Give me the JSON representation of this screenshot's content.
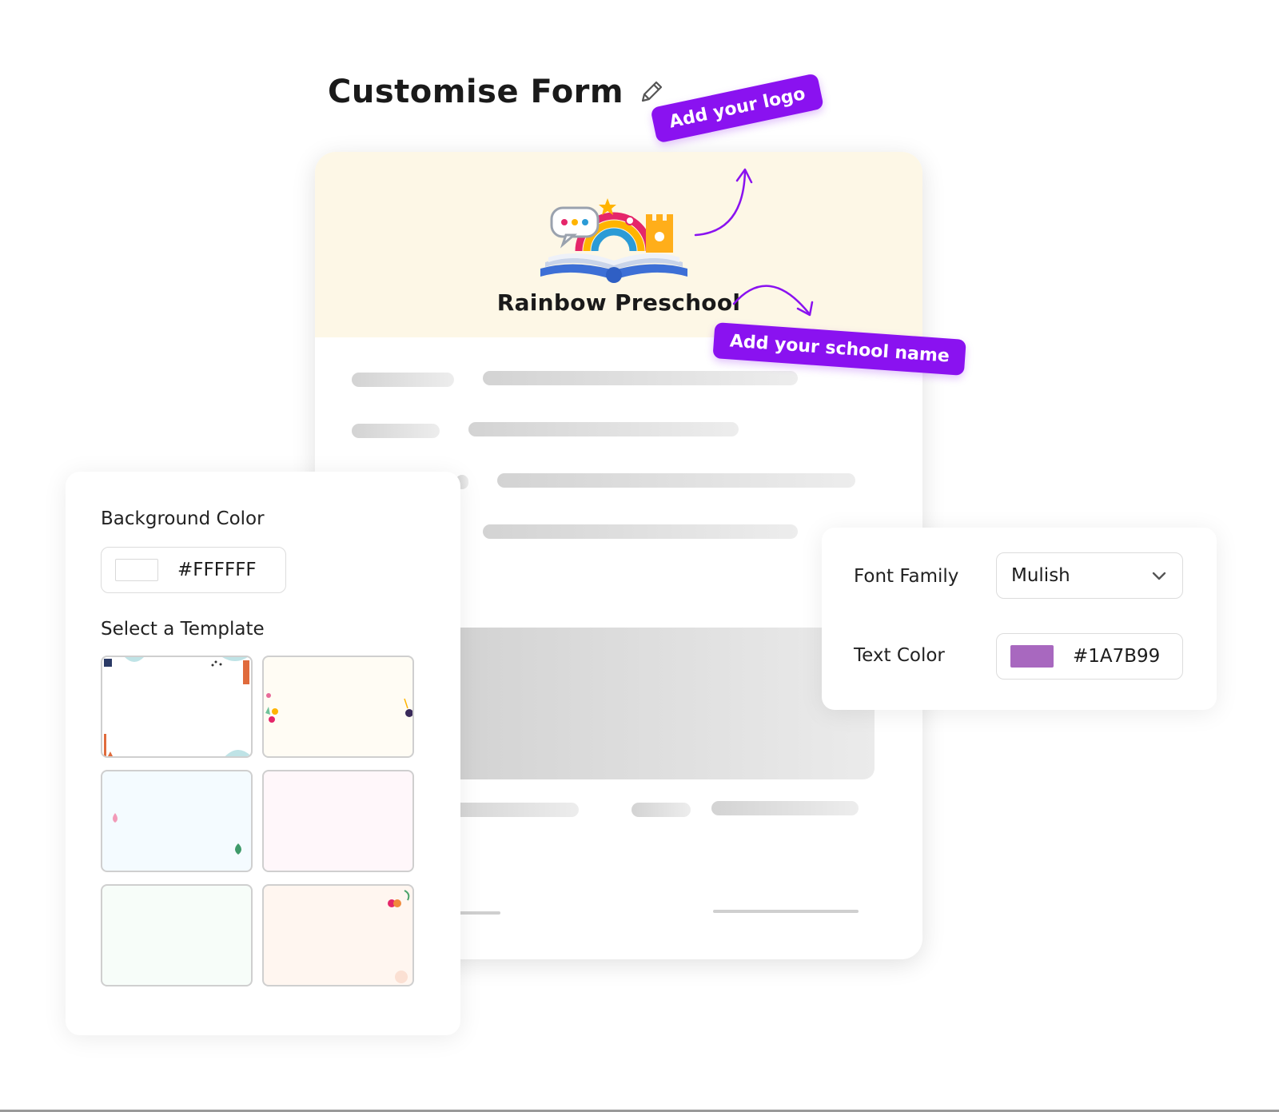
{
  "page": {
    "title": "Customise Form",
    "edit_icon": "pencil-icon"
  },
  "form_preview": {
    "school_name": "Rainbow Preschool",
    "logo": "open-book-rainbow-logo",
    "header_color": "#fdf7e6"
  },
  "callouts": {
    "logo": "Add your logo",
    "school_name": "Add your school name",
    "color": "#8a12f0"
  },
  "background_panel": {
    "label": "Background Color",
    "value": "#FFFFFF",
    "template_label": "Select a Template",
    "templates": [
      {
        "name": "template-confetti",
        "color": "#ffffff"
      },
      {
        "name": "template-cream",
        "color": "#fffcf4"
      },
      {
        "name": "template-sky",
        "color": "#f4fbff"
      },
      {
        "name": "template-blush",
        "color": "#fff7fa"
      },
      {
        "name": "template-mint",
        "color": "#f7fdf9"
      },
      {
        "name": "template-peach",
        "color": "#fff6f0"
      }
    ]
  },
  "style_panel": {
    "font_family_label": "Font Family",
    "font_family_value": "Mulish",
    "dropdown_icon": "chevron-down-icon",
    "text_color_label": "Text Color",
    "text_color_value": "#1A7B99",
    "text_color_swatch": "#a868bf"
  }
}
